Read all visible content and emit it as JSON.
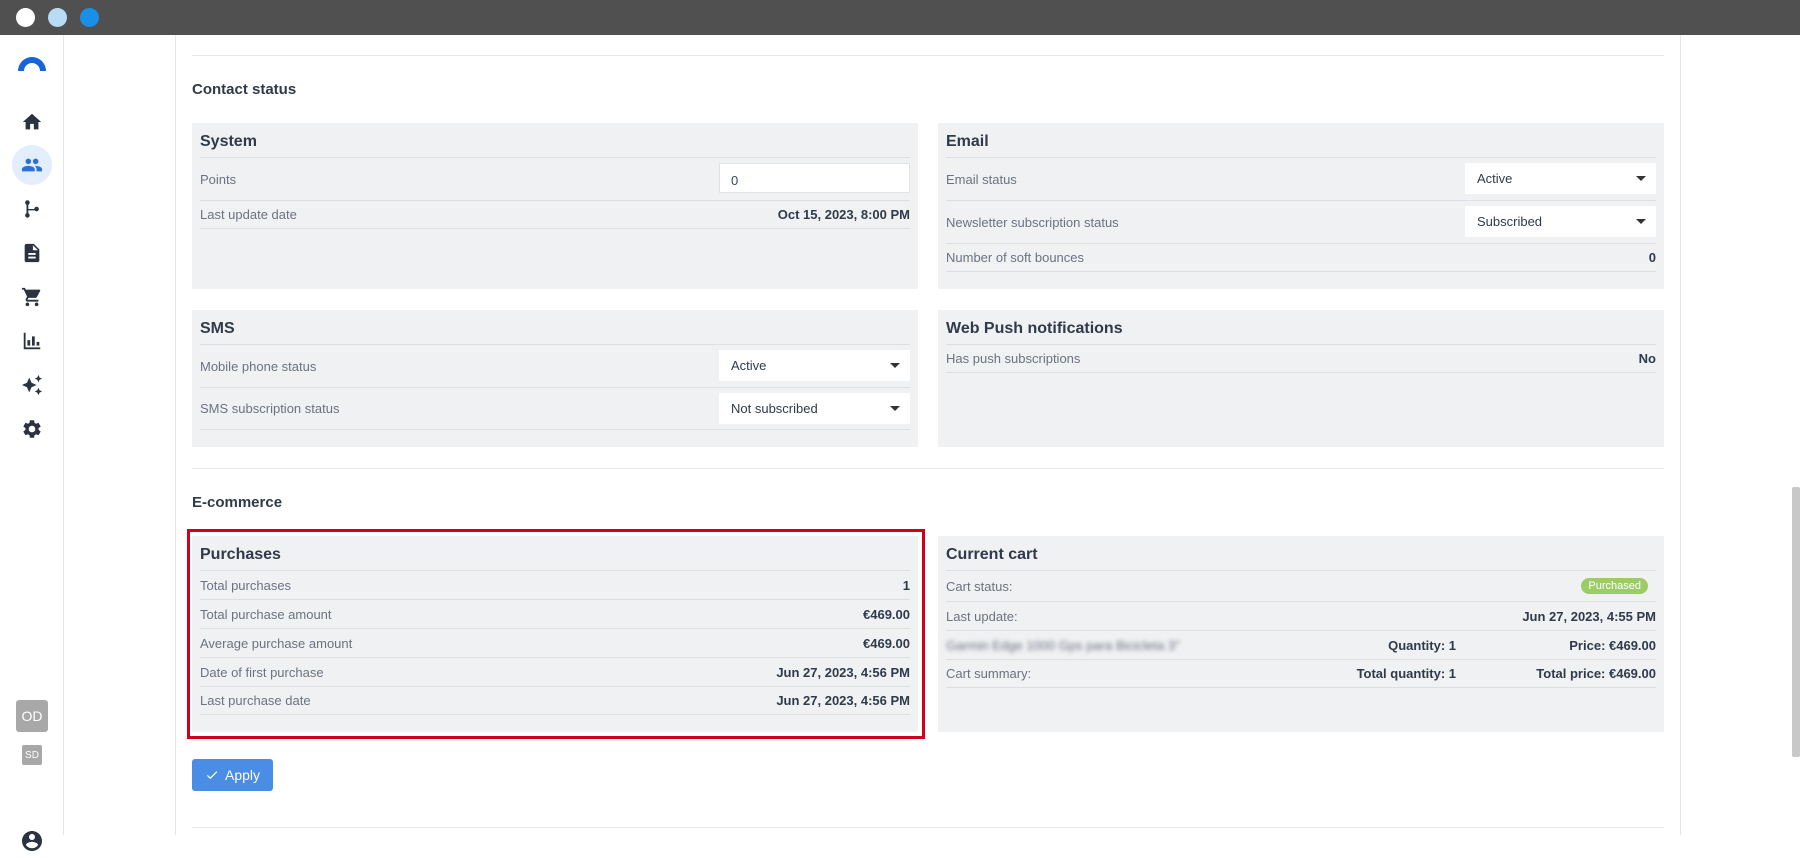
{
  "sidebar": {
    "icons": [
      "home-icon",
      "contacts-icon",
      "workflow-icon",
      "document-icon",
      "cart-icon",
      "chart-icon",
      "ai-sparkle-icon",
      "gear-icon"
    ],
    "avatar_od": "OD",
    "avatar_sd": "SD"
  },
  "contact_status": {
    "title": "Contact status",
    "system": {
      "title": "System",
      "points_label": "Points",
      "points_value": "0",
      "last_update_label": "Last update date",
      "last_update_value": "Oct 15, 2023, 8:00 PM"
    },
    "email": {
      "title": "Email",
      "email_status_label": "Email status",
      "email_status_value": "Active",
      "newsletter_label": "Newsletter subscription status",
      "newsletter_value": "Subscribed",
      "soft_bounces_label": "Number of soft bounces",
      "soft_bounces_value": "0"
    },
    "sms": {
      "title": "SMS",
      "mobile_status_label": "Mobile phone status",
      "mobile_status_value": "Active",
      "sms_sub_label": "SMS subscription status",
      "sms_sub_value": "Not subscribed"
    },
    "web_push": {
      "title": "Web Push notifications",
      "has_push_label": "Has push subscriptions",
      "has_push_value": "No"
    }
  },
  "ecommerce": {
    "title": "E-commerce",
    "purchases": {
      "title": "Purchases",
      "rows": [
        {
          "label": "Total purchases",
          "value": "1"
        },
        {
          "label": "Total purchase amount",
          "value": "€469.00"
        },
        {
          "label": "Average purchase amount",
          "value": "€469.00"
        },
        {
          "label": "Date of first purchase",
          "value": "Jun 27, 2023, 4:56 PM"
        },
        {
          "label": "Last purchase date",
          "value": "Jun 27, 2023, 4:56 PM"
        }
      ]
    },
    "current_cart": {
      "title": "Current cart",
      "status_label": "Cart status:",
      "status_badge": "Purchased",
      "status_color": "#9ccc65",
      "last_update_label": "Last update:",
      "last_update_value": "Jun 27, 2023, 4:55 PM",
      "item_name": "Garmin Edge 1000 Gps para Bicicleta 3\"",
      "item_quantity": "Quantity: 1",
      "item_price": "Price: €469.00",
      "summary_label": "Cart summary:",
      "summary_quantity": "Total quantity: 1",
      "summary_price": "Total price: €469.00"
    }
  },
  "actions": {
    "apply_label": "Apply"
  },
  "colors": {
    "accent": "#4a8de6",
    "highlight": "#d0021b"
  }
}
